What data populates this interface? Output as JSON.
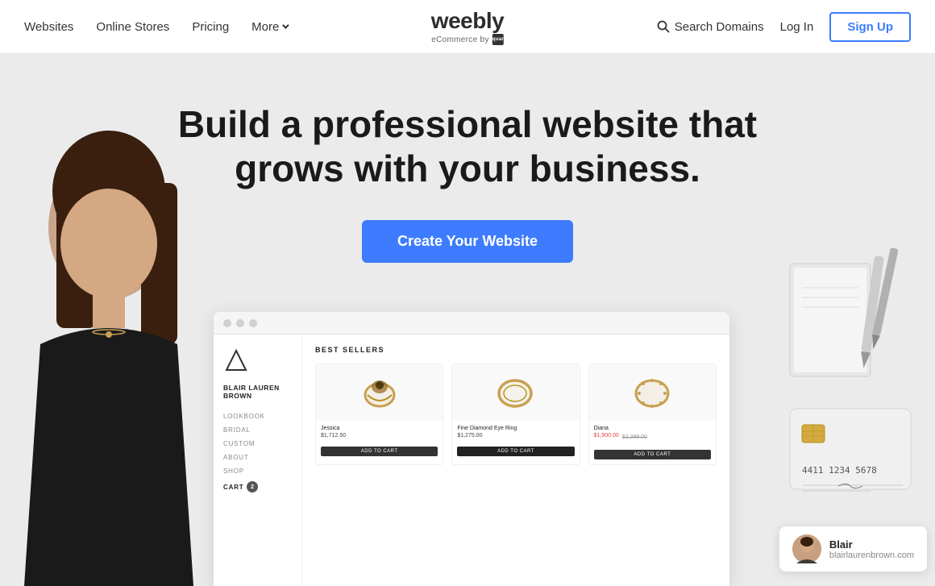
{
  "nav": {
    "links": [
      {
        "label": "Websites",
        "id": "websites"
      },
      {
        "label": "Online Stores",
        "id": "online-stores"
      },
      {
        "label": "Pricing",
        "id": "pricing"
      },
      {
        "label": "More",
        "id": "more",
        "hasDropdown": true
      }
    ],
    "logo": {
      "text": "weebly",
      "sub": "eCommerce by",
      "square_label": "Square"
    },
    "search_domains": "Search Domains",
    "login": "Log In",
    "signup": "Sign Up"
  },
  "hero": {
    "headline": "Build a professional website that grows with your business.",
    "cta": "Create Your Website"
  },
  "mockup": {
    "brand_name": "BLAIR LAUREN BROWN",
    "section_title": "BEST SELLERS",
    "nav_items": [
      "LOOKBOOK",
      "BRIDAL",
      "CUSTOM",
      "ABOUT",
      "SHOP"
    ],
    "cart_label": "CART",
    "cart_count": "2",
    "products": [
      {
        "name": "Jessica",
        "price": "$1,712.50",
        "btn": "ADD TO CART"
      },
      {
        "name": "Fine Diamond Eye Ring",
        "price": "$1,275.00",
        "btn": "ADD TO CART"
      },
      {
        "name": "Diana",
        "price": "$1,900.00",
        "old_price": "$2,299.00",
        "btn": "ADD TO CART",
        "sale": true
      }
    ]
  },
  "blair": {
    "name": "Blair",
    "url": "blairlaurenbrown.com"
  }
}
